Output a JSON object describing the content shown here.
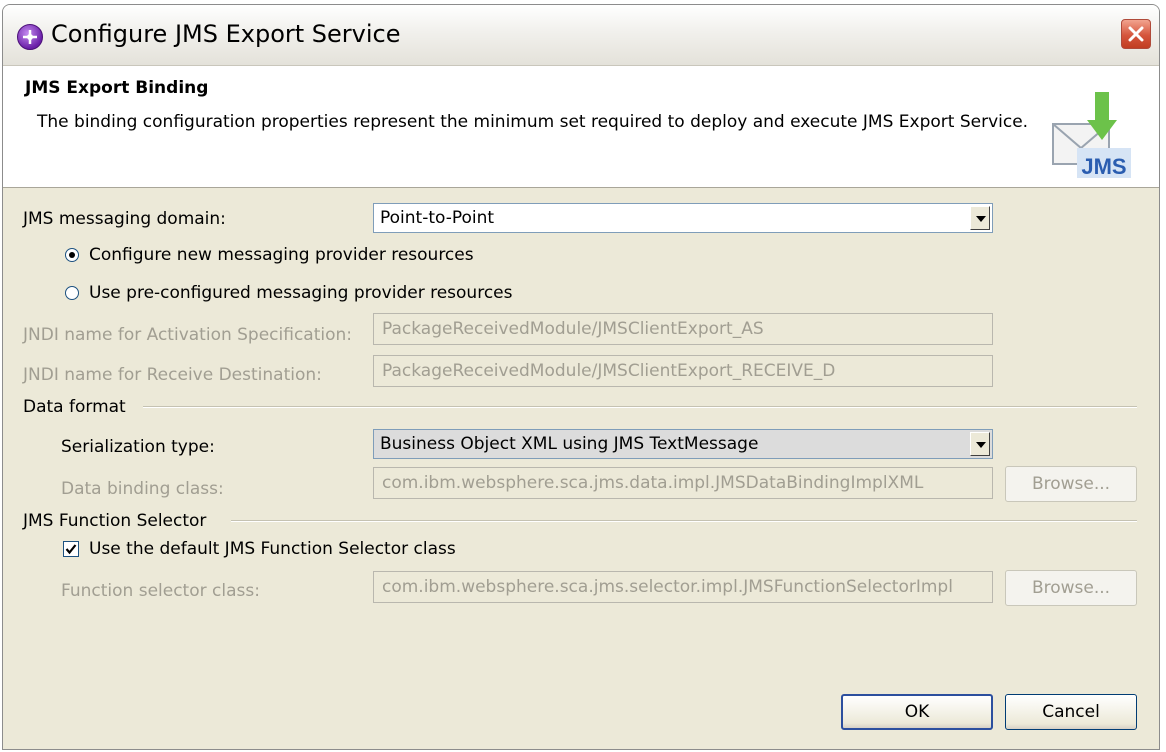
{
  "window": {
    "title": "Configure JMS Export Service"
  },
  "banner": {
    "title": "JMS Export Binding",
    "description": "The binding configuration properties represent the minimum set required to deploy and execute JMS Export Service.",
    "icon_text": "JMS"
  },
  "messaging": {
    "domain_label": "JMS messaging domain:",
    "domain_value": "Point-to-Point",
    "radio_new_label": "Configure new messaging provider resources",
    "radio_new_checked": true,
    "radio_pre_label": "Use pre-configured messaging provider resources",
    "radio_pre_checked": false,
    "jndi_activation_label": "JNDI name for Activation Specification:",
    "jndi_activation_value": "PackageReceivedModule/JMSClientExport_AS",
    "jndi_receive_label": "JNDI name for Receive Destination:",
    "jndi_receive_value": "PackageReceivedModule/JMSClientExport_RECEIVE_D"
  },
  "data_format": {
    "group_label": "Data format",
    "serialization_label": "Serialization type:",
    "serialization_value": "Business Object XML using JMS TextMessage",
    "binding_class_label": "Data binding class:",
    "binding_class_value": "com.ibm.websphere.sca.jms.data.impl.JMSDataBindingImplXML",
    "browse_label": "Browse..."
  },
  "function_selector": {
    "group_label": "JMS Function Selector",
    "use_default_label": "Use the default JMS Function Selector class",
    "use_default_checked": true,
    "class_label": "Function selector class:",
    "class_value": "com.ibm.websphere.sca.jms.selector.impl.JMSFunctionSelectorImpl",
    "browse_label": "Browse..."
  },
  "buttons": {
    "ok_label": "OK",
    "cancel_label": "Cancel"
  }
}
